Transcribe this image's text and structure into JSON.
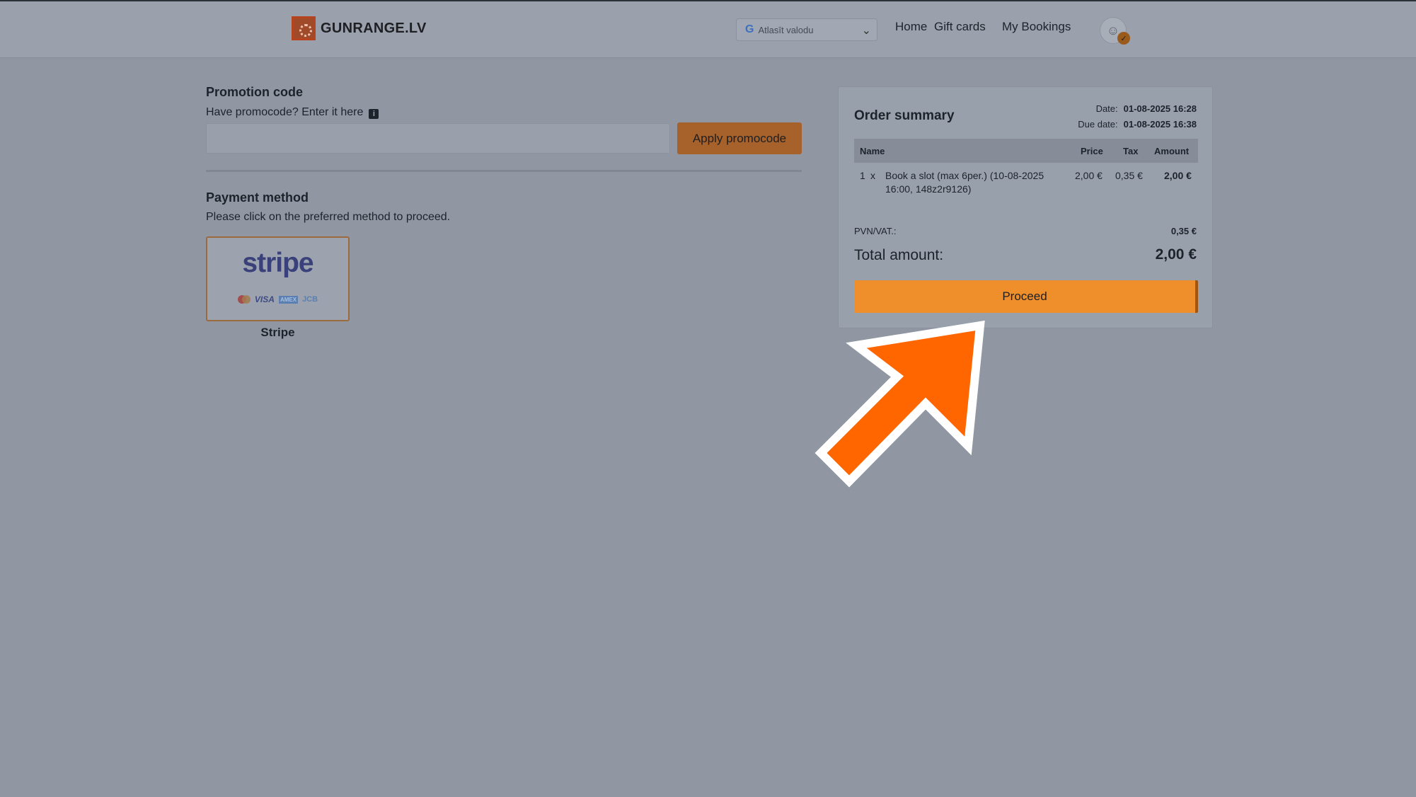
{
  "header": {
    "logo_text": "GUNRANGE.LV",
    "language_placeholder": "Atlasīt valodu",
    "nav": [
      "Home",
      "Gift cards",
      "My Bookings"
    ]
  },
  "promo": {
    "title": "Promotion code",
    "subtitle": "Have promocode? Enter it here",
    "input_value": "",
    "apply_label": "Apply promocode"
  },
  "payment": {
    "title": "Payment method",
    "subtitle": "Please click on the preferred method to proceed.",
    "logo_word": "stripe",
    "card_brands": [
      "VISA",
      "AMEX",
      "JCB"
    ],
    "option_label": "Stripe"
  },
  "summary": {
    "title": "Order summary",
    "date_label": "Date:",
    "date_value": "01-08-2025 16:28",
    "due_label": "Due date:",
    "due_value": "01-08-2025 16:38",
    "columns": {
      "name": "Name",
      "price": "Price",
      "tax": "Tax",
      "amount": "Amount"
    },
    "items": [
      {
        "qty": "1",
        "x": "x",
        "name_line1": "Book a slot (max 6per.) (10-08-2025",
        "name_line2": "16:00, 148z2r9126)",
        "price": "2,00 €",
        "tax": "0,35 €",
        "amount": "2,00 €"
      }
    ],
    "vat_label": "PVN/VAT.:",
    "vat_value": "0,35 €",
    "total_label": "Total amount:",
    "total_value": "2,00 €",
    "proceed_label": "Proceed"
  },
  "colors": {
    "accent": "#ef8f2c",
    "overlay_arrow": "#ff6600"
  }
}
